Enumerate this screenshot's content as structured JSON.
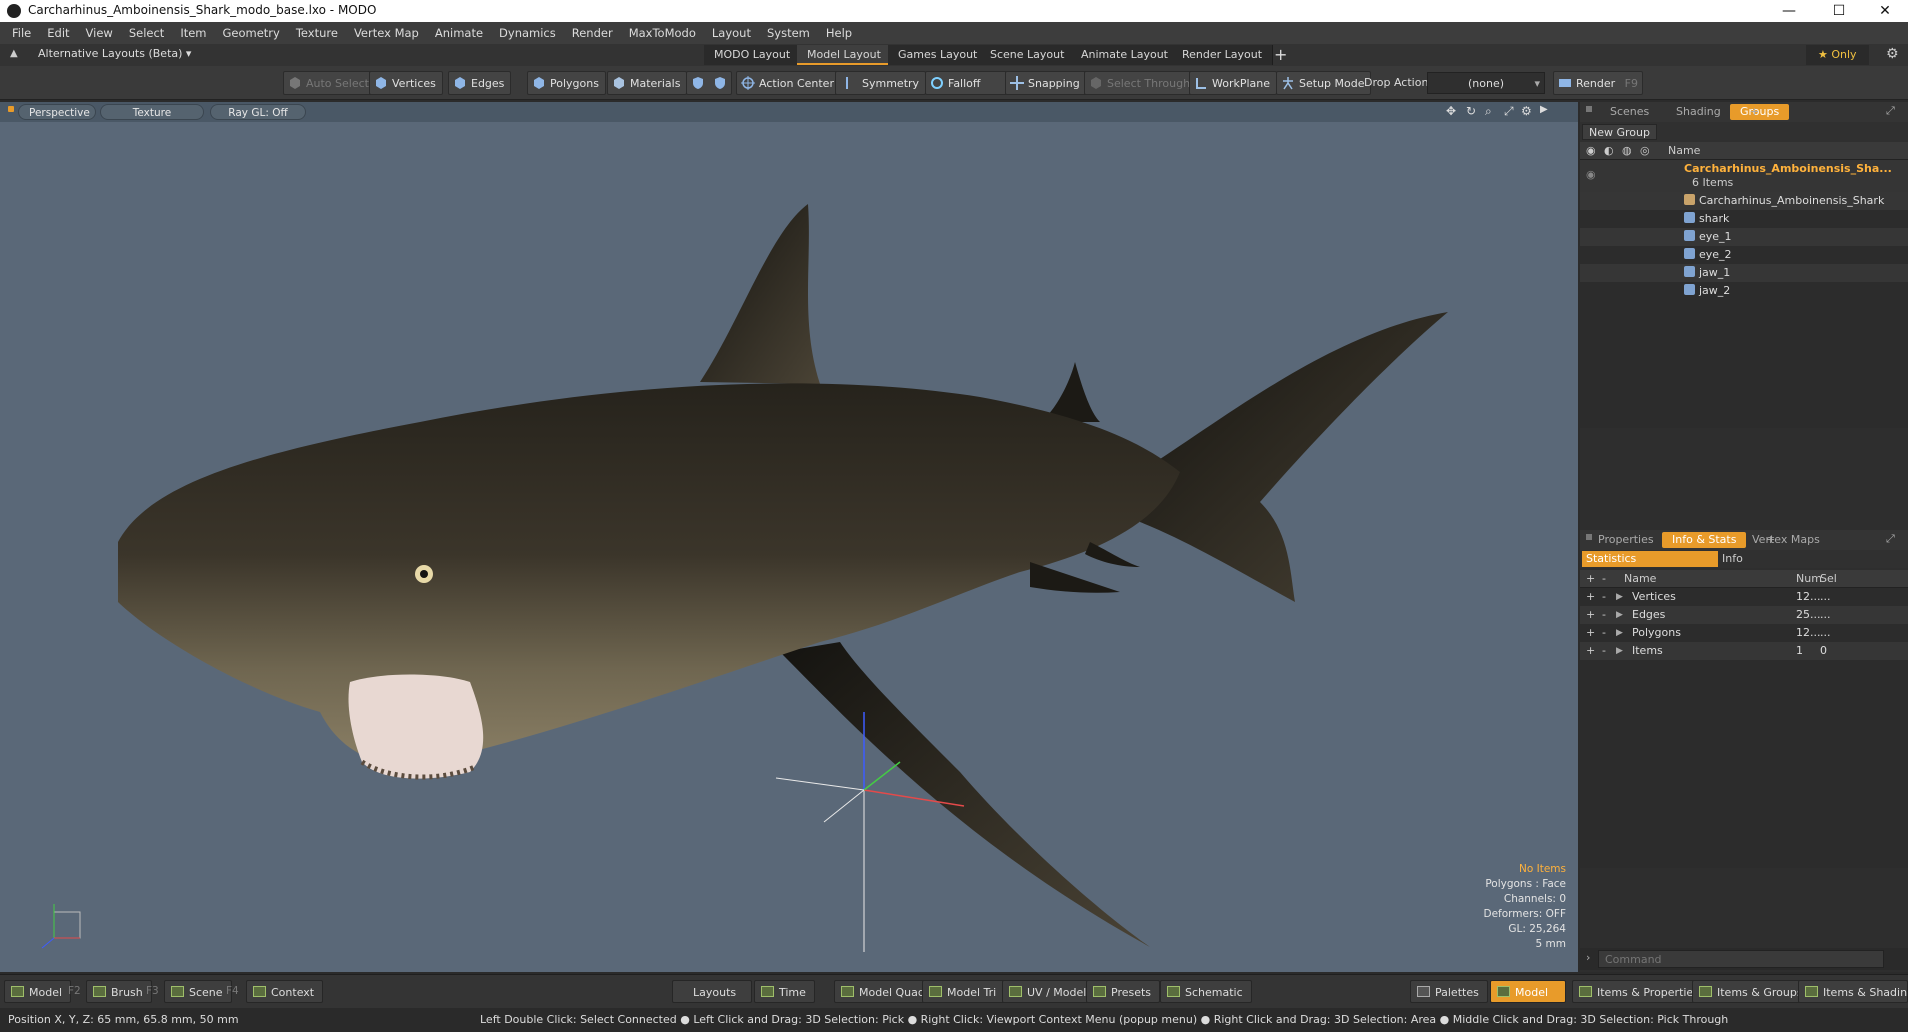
{
  "window": {
    "title": "Carcharhinus_Amboinensis_Shark_modo_base.lxo - MODO",
    "minimize": "—",
    "maximize": "☐",
    "close": "✕"
  },
  "menu": [
    "File",
    "Edit",
    "View",
    "Select",
    "Item",
    "Geometry",
    "Texture",
    "Vertex Map",
    "Animate",
    "Dynamics",
    "Render",
    "MaxToModo",
    "Layout",
    "System",
    "Help"
  ],
  "layoutbar": {
    "alt_layouts": "Alternative Layouts (Beta) ▾",
    "tabs": [
      "MODO Layout",
      "Model Layout",
      "Games Layout",
      "Scene Layout",
      "Animate Layout",
      "Render Layout"
    ],
    "active_tab": "Model Layout",
    "add": "+",
    "only": "★  Only"
  },
  "toolbar": {
    "auto_select": "Auto Select",
    "vertices": "Vertices",
    "edges": "Edges",
    "polygons": "Polygons",
    "materials": "Materials",
    "action_center": "Action Center",
    "symmetry": "Symmetry",
    "falloff": "Falloff",
    "snapping": "Snapping",
    "select_through": "Select Through",
    "workplane": "WorkPlane",
    "setup_mode": "Setup Mode",
    "drop_action": "Drop Action",
    "drop_value": "(none)",
    "render": "Render",
    "render_key": "F9"
  },
  "viewport": {
    "perspective": "Perspective",
    "texture": "Texture",
    "raygl": "Ray GL: Off",
    "info": {
      "no_items": "No Items",
      "polygons": "Polygons : Face",
      "channels": "Channels: 0",
      "deformers": "Deformers: OFF",
      "gl": "GL: 25,264",
      "scale": "5 mm"
    }
  },
  "scene_panel": {
    "tabs": [
      "Scenes",
      "Shading",
      "Groups"
    ],
    "active_tab": "Groups",
    "add": "+",
    "new_group": "New Group",
    "col_name": "Name",
    "group_name": "Carcharhinus_Amboinensis_Sha...",
    "group_count": "6 Items",
    "items": [
      "Carcharhinus_Amboinensis_Shark",
      "shark",
      "eye_1",
      "eye_2",
      "jaw_1",
      "jaw_2"
    ]
  },
  "info_panel": {
    "tabs": [
      "Properties",
      "Info & Stats",
      "Vertex Maps"
    ],
    "active_tab": "Info & Stats",
    "add": "+",
    "sub_statistics": "Statistics",
    "sub_info": "Info",
    "col_name": "Name",
    "col_num": "Num",
    "col_sel": "Sel",
    "rows": [
      {
        "name": "Vertices",
        "num": "12...",
        "sel": "..."
      },
      {
        "name": "Edges",
        "num": "25...",
        "sel": "..."
      },
      {
        "name": "Polygons",
        "num": "12...",
        "sel": "..."
      },
      {
        "name": "Items",
        "num": "1",
        "sel": "0"
      }
    ],
    "command_placeholder": "Command"
  },
  "bottombar": {
    "model": "Model",
    "model_key": "F2",
    "brush": "Brush",
    "brush_key": "F3",
    "scene": "Scene",
    "scene_key": "F4",
    "context": "Context",
    "layouts": "Layouts",
    "time": "Time",
    "model_quad": "Model Quad",
    "model_tri": "Model Tri",
    "uv_model": "UV / Model",
    "presets": "Presets",
    "schematic": "Schematic",
    "palettes": "Palettes",
    "model_active": "Model",
    "items_props": "Items & Properties",
    "items_groups": "Items & Groups",
    "items_shading": "Items & Shading"
  },
  "statusbar": {
    "position": "Position X, Y, Z:   65 mm, 65.8 mm, 50 mm",
    "hints": "Left Double Click: Select Connected ● Left Click and Drag: 3D Selection: Pick ● Right Click: Viewport Context Menu (popup menu) ● Right Click and Drag: 3D Selection: Area ● Middle Click and Drag: 3D Selection: Pick Through"
  },
  "colors": {
    "accent": "#e89b2a",
    "viewport_bg": "#5a6878",
    "highlight_text": "#ffb23c"
  }
}
